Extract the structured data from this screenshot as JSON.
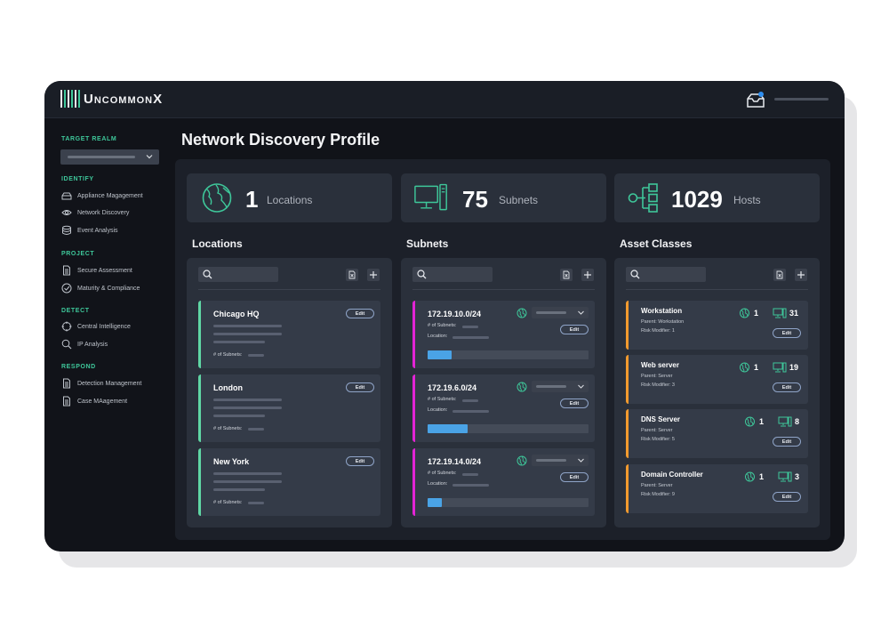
{
  "app": {
    "brand": "UncommonX"
  },
  "colors": {
    "accent_green": "#3ec79a",
    "location_accent": "#5fd6a4",
    "subnet_accent": "#e324d6",
    "asset_accent": "#f29a2e",
    "progress_fill": "#4aa3e6",
    "notification_dot": "#2f8ff0"
  },
  "sidebar": {
    "target_realm_label": "TARGET REALM",
    "sections": [
      {
        "label": "IDENTIFY",
        "items": [
          {
            "label": "Appliance Magagement",
            "icon": "appliance-icon"
          },
          {
            "label": "Network Discovery",
            "icon": "eye-icon"
          },
          {
            "label": "Event Analysis",
            "icon": "database-icon"
          }
        ]
      },
      {
        "label": "PROJECT",
        "items": [
          {
            "label": "Secure Assessment",
            "icon": "document-icon"
          },
          {
            "label": "Maturity & Compliance",
            "icon": "check-circle-icon"
          }
        ]
      },
      {
        "label": "DETECT",
        "items": [
          {
            "label": "Central Intelligence",
            "icon": "crosshair-icon"
          },
          {
            "label": "IP Analysis",
            "icon": "search-icon"
          }
        ]
      },
      {
        "label": "RESPOND",
        "items": [
          {
            "label": "Detection Management",
            "icon": "document-icon"
          },
          {
            "label": "Case MAagement",
            "icon": "document-icon"
          }
        ]
      }
    ]
  },
  "page": {
    "title": "Network Discovery Profile"
  },
  "stats": [
    {
      "value": "1",
      "label": "Locations",
      "icon": "globe-icon"
    },
    {
      "value": "75",
      "label": "Subnets",
      "icon": "computer-icon"
    },
    {
      "value": "1029",
      "label": "Hosts",
      "icon": "network-tree-icon"
    }
  ],
  "columns": {
    "locations": "Locations",
    "subnets": "Subnets",
    "asset_classes": "Asset Classes"
  },
  "edit_label": "Edit",
  "locations": [
    {
      "name": "Chicago HQ",
      "subnets_label": "# of Subnets:"
    },
    {
      "name": "London",
      "subnets_label": "# of Subnets:"
    },
    {
      "name": "New York",
      "subnets_label": "# of Subnets:"
    }
  ],
  "subnets": [
    {
      "cidr": "172.19.10.0/24",
      "subnets_label": "# of Subnets:",
      "location_label": "Location:",
      "progress": 0.15
    },
    {
      "cidr": "172.19.6.0/24",
      "subnets_label": "# of Subnets:",
      "location_label": "Location:",
      "progress": 0.25
    },
    {
      "cidr": "172.19.14.0/24",
      "subnets_label": "# of Subnets:",
      "location_label": "Location:",
      "progress": 0.09
    }
  ],
  "assets": [
    {
      "name": "Workstation",
      "parent": "Parent: Workstation",
      "risk": "Risk Modifier: 1",
      "locations": "1",
      "hosts": "31"
    },
    {
      "name": "Web server",
      "parent": "Parent: Server",
      "risk": "Risk Modifier: 3",
      "locations": "1",
      "hosts": "19"
    },
    {
      "name": "DNS Server",
      "parent": "Parent: Server",
      "risk": "Risk Modifier: 5",
      "locations": "1",
      "hosts": "8"
    },
    {
      "name": "Domain Controller",
      "parent": "Parent: Server",
      "risk": "Risk Modifier: 9",
      "locations": "1",
      "hosts": "3"
    }
  ]
}
